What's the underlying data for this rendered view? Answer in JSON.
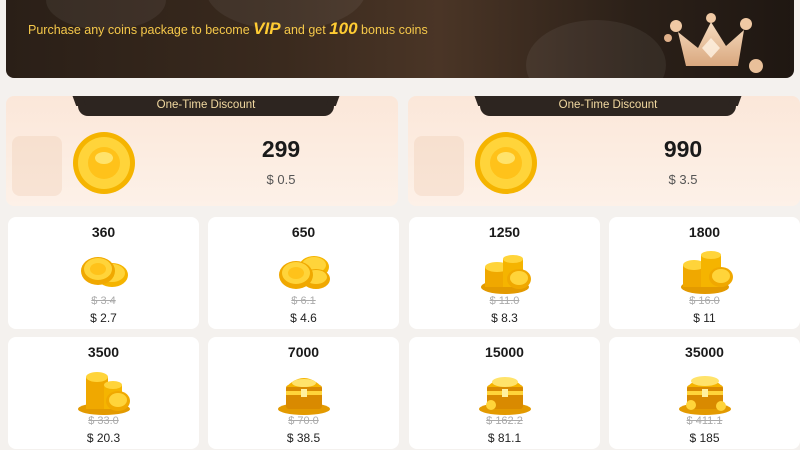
{
  "banner": {
    "text_before": "Purchase any coins package to become ",
    "vip": "VIP",
    "text_middle": " and get ",
    "bonus": "100",
    "text_after": " bonus coins"
  },
  "discounts": [
    {
      "tab": "One-Time Discount",
      "amount": "299",
      "price": "$ 0.5"
    },
    {
      "tab": "One-Time Discount",
      "amount": "990",
      "price": "$ 3.5"
    }
  ],
  "packages": [
    {
      "amount": "360",
      "old_price": "$ 3.4",
      "price": "$ 2.7",
      "icon": "coin-stack-icon"
    },
    {
      "amount": "650",
      "old_price": "$ 6.1",
      "price": "$ 4.6",
      "icon": "coin-stack-icon"
    },
    {
      "amount": "1250",
      "old_price": "$ 11.0",
      "price": "$ 8.3",
      "icon": "coin-pile-icon"
    },
    {
      "amount": "1800",
      "old_price": "$ 16.0",
      "price": "$ 11",
      "icon": "coin-pile-icon"
    },
    {
      "amount": "3500",
      "old_price": "$ 33.0",
      "price": "$ 20.3",
      "icon": "coin-tower-icon"
    },
    {
      "amount": "7000",
      "old_price": "$ 70.0",
      "price": "$ 38.5",
      "icon": "treasure-chest-icon"
    },
    {
      "amount": "15000",
      "old_price": "$ 162.2",
      "price": "$ 81.1",
      "icon": "treasure-chest-icon"
    },
    {
      "amount": "35000",
      "old_price": "$ 411.1",
      "price": "$ 185",
      "icon": "treasure-chest-icon"
    }
  ],
  "colors": {
    "gold": "#ffcc33",
    "banner_bg": "#2a1f17",
    "discount_bg": "#fbe7d9",
    "tab_bg": "#2d2520"
  }
}
